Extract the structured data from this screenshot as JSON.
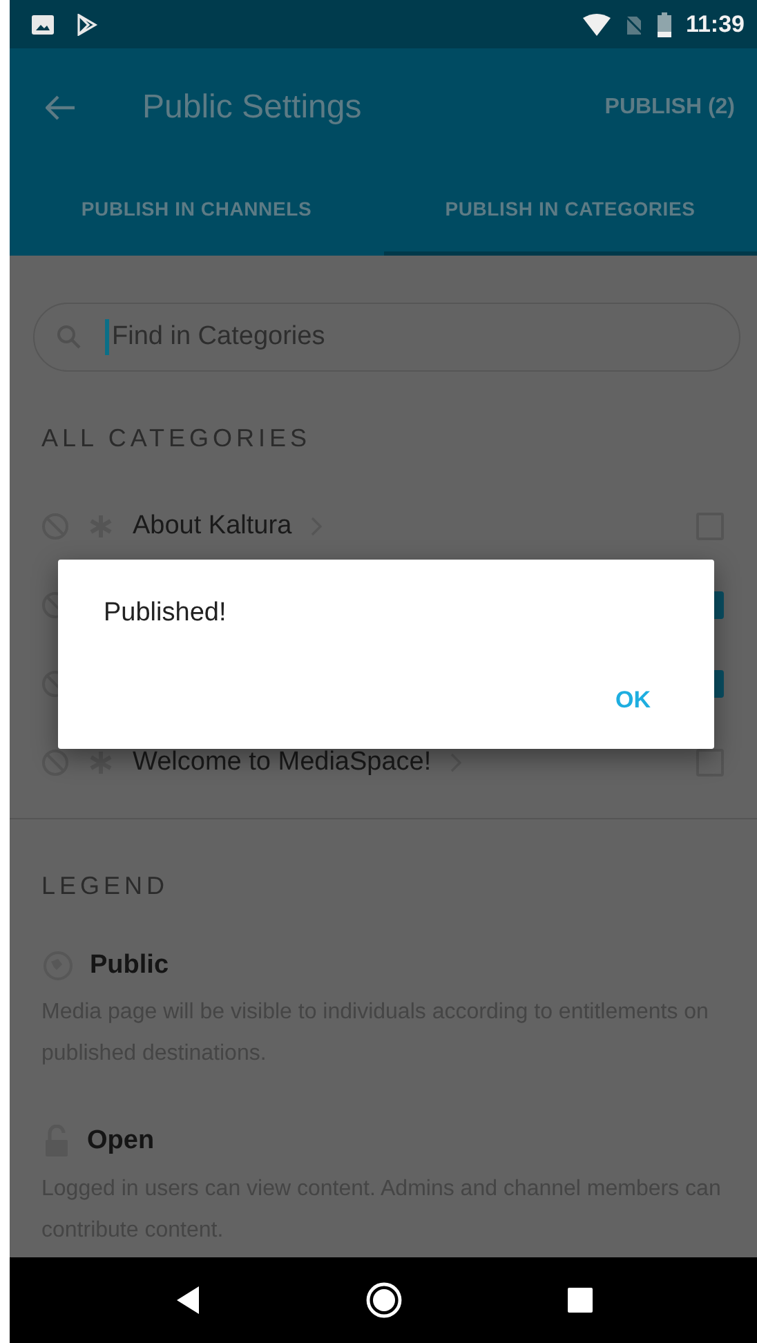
{
  "status_bar": {
    "time": "11:39"
  },
  "toolbar": {
    "title": "Public Settings",
    "action": "PUBLISH (2)"
  },
  "tabs": [
    {
      "label": "PUBLISH IN CHANNELS",
      "selected": false
    },
    {
      "label": "PUBLISH IN CATEGORIES",
      "selected": true
    }
  ],
  "search": {
    "placeholder": "Find in Categories"
  },
  "section_title": "ALL CATEGORIES",
  "categories": [
    {
      "name": "About Kaltura",
      "checked": false
    },
    {
      "checked": true
    },
    {
      "checked": true
    },
    {
      "name": "Welcome to MediaSpace!",
      "checked": false
    }
  ],
  "legend": {
    "title": "LEGEND",
    "items": [
      {
        "kind": "public",
        "title": "Public",
        "description": "Media page will be visible to individuals according to entitlements on published destinations."
      },
      {
        "kind": "open",
        "title": "Open",
        "description": "Logged in users can view content. Admins and channel members can contribute content."
      }
    ]
  },
  "dialog": {
    "message": "Published!",
    "button": "OK"
  }
}
